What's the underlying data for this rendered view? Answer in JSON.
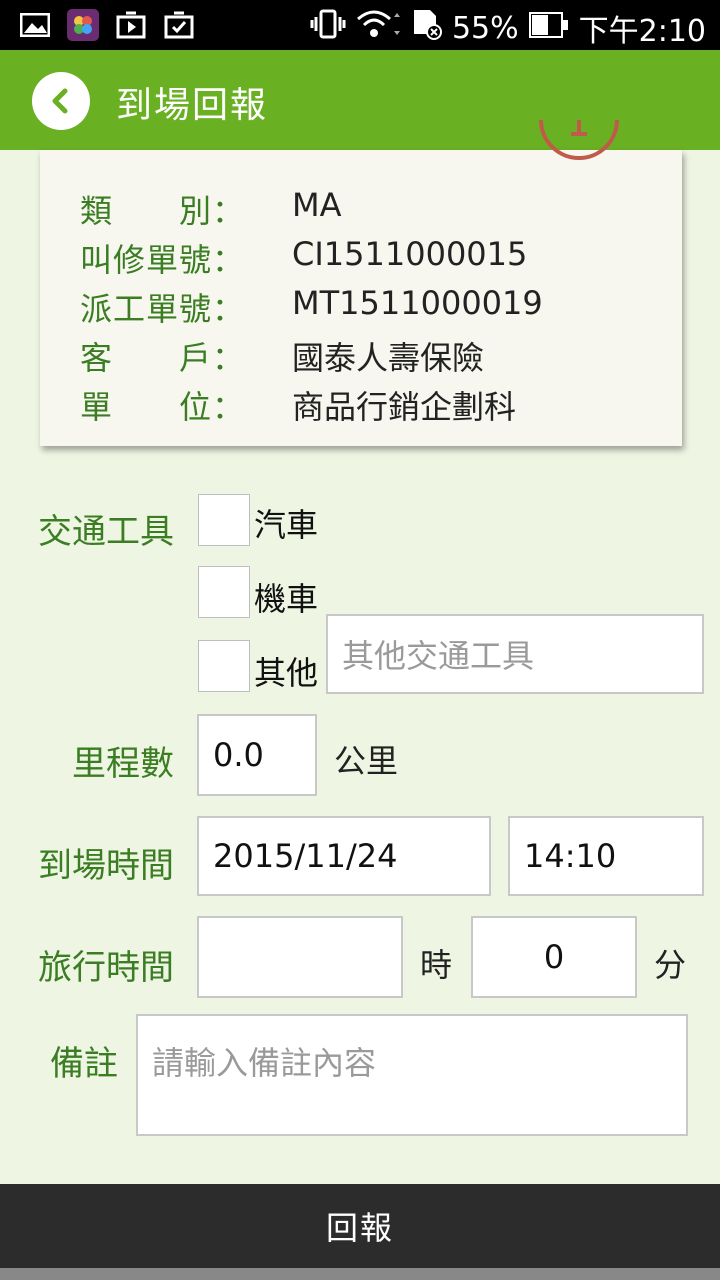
{
  "status_bar": {
    "icons_left": [
      "image-icon",
      "photos-icon",
      "play-store-icon",
      "shopping-bag-icon"
    ],
    "battery": "55%",
    "time": "下午2:10"
  },
  "header": {
    "title": "到場回報"
  },
  "info": {
    "rows": [
      {
        "label": "類　　別：",
        "value": "MA"
      },
      {
        "label": "叫修單號：",
        "value": "CI1511000015"
      },
      {
        "label": "派工單號：",
        "value": "MT1511000019"
      },
      {
        "label": "客　　戶：",
        "value": "國泰人壽保險"
      },
      {
        "label": "單　　位：",
        "value": "商品行銷企劃科"
      }
    ]
  },
  "form": {
    "transport_label": "交通工具",
    "transport_options": [
      {
        "label": "汽車",
        "checked": false
      },
      {
        "label": "機車",
        "checked": false
      },
      {
        "label": "其他",
        "checked": false
      }
    ],
    "other_transport_placeholder": "其他交通工具",
    "mileage_label": "里程數",
    "mileage_value": "0.0",
    "mileage_unit": "公里",
    "arrival_label": "到場時間",
    "arrival_date": "2015/11/24",
    "arrival_time": "14:10",
    "travel_label": "旅行時間",
    "travel_hours": "",
    "travel_hours_unit": "時",
    "travel_minutes": "0",
    "travel_minutes_unit": "分",
    "note_label": "備註",
    "note_placeholder": "請輸入備註內容"
  },
  "footer": {
    "submit_label": "回報"
  },
  "colors": {
    "accent": "#6ab023",
    "label": "#3a7d22",
    "background": "#eef5e3"
  }
}
